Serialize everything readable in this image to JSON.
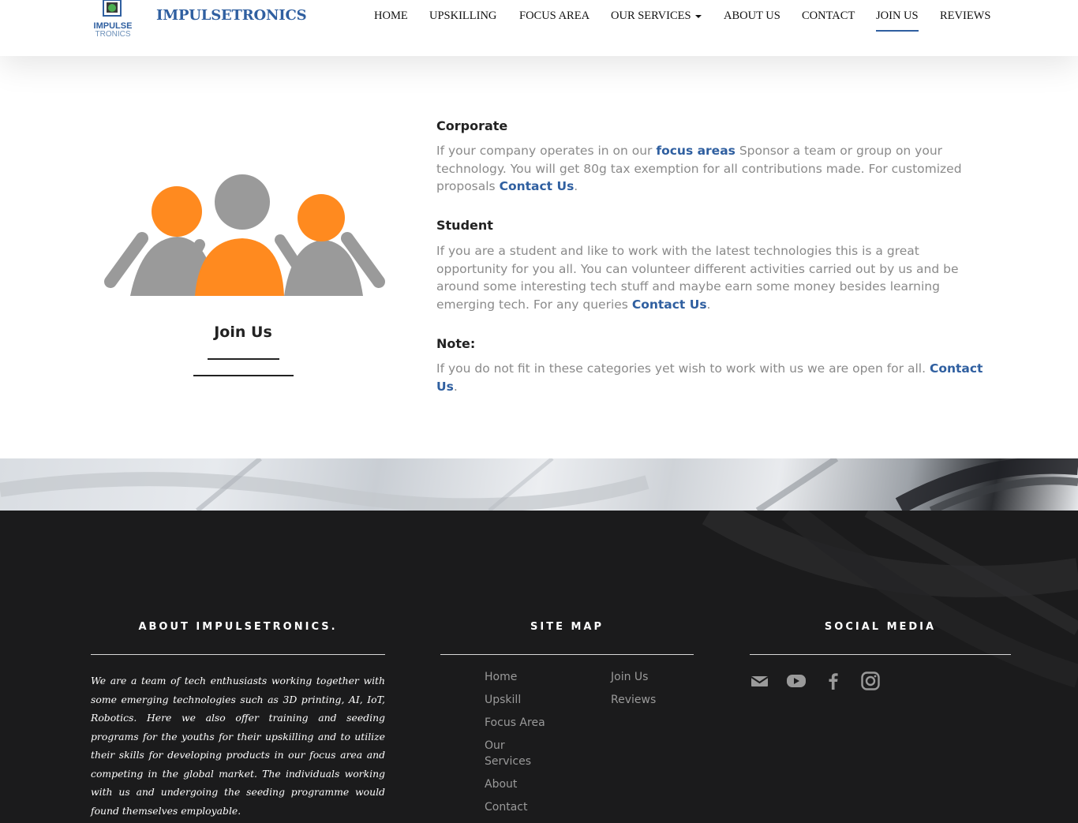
{
  "header": {
    "brand": "IMPULSETRONICS",
    "logo_text_top": "IMPULSE",
    "logo_text_bottom": "TRONICS",
    "nav": [
      {
        "label": "HOME"
      },
      {
        "label": "UPSKILLING"
      },
      {
        "label": "FOCUS AREA"
      },
      {
        "label": "OUR SERVICES"
      },
      {
        "label": "ABOUT US"
      },
      {
        "label": "CONTACT"
      },
      {
        "label": "JOIN US"
      },
      {
        "label": "REVIEWS"
      }
    ],
    "active_nav": "JOIN US"
  },
  "main": {
    "join_title": "Join Us",
    "corporate": {
      "heading": "Corporate",
      "text1": "If your company operates in on our ",
      "link1": "focus areas",
      "text2": " Sponsor a team or group on your technology. You will get 80g tax exemption for all contributions made. For customized proposals ",
      "link2": "Contact Us",
      "text3": "."
    },
    "student": {
      "heading": "Student",
      "text1": "If you are a student and like to work with the latest technologies this is a great opportunity for you all. You can volunteer different activities carried out by us and be around some interesting tech stuff and maybe earn some money besides learning emerging tech. For any queries ",
      "link1": "Contact Us",
      "text2": "."
    },
    "note": {
      "heading": "Note:",
      "text1": "If you do not fit in these categories yet wish to work with us we are open for all. ",
      "link1": "Contact Us",
      "text2": "."
    }
  },
  "footer": {
    "about_title": "ABOUT IMPULSETRONICS.",
    "about_text": "We are a team of tech enthusiasts working together with some emerging technologies such as 3D printing, AI, IoT, Robotics. Here we also offer training and seeding programs for the youths for their upskilling and to utilize their skills for developing products in our focus area and competing in the global market. The individuals working with us and undergoing the seeding programme would found themselves employable.",
    "sitemap_title": "SITE MAP",
    "sitemap_col1": [
      "Home",
      "Upskill",
      "Focus Area",
      "Our",
      "Services",
      "About",
      "Contact"
    ],
    "sitemap_col2": [
      "Join Us",
      "Reviews"
    ],
    "social_title": "SOCIAL MEDIA",
    "social_icons": [
      "mail-icon",
      "youtube-icon",
      "facebook-icon",
      "instagram-icon"
    ]
  },
  "colors": {
    "brand_blue": "#2f5fa0",
    "illustration_orange": "#ff8a1f",
    "illustration_gray": "#9a9a9a",
    "footer_bg": "#1b1b1c"
  }
}
